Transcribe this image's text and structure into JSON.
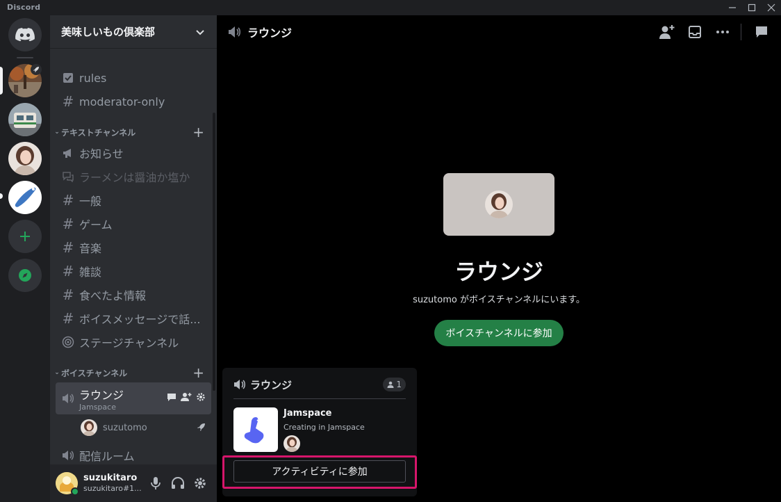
{
  "window": {
    "brand": "Discord"
  },
  "guild": {
    "name": "美味しいもの倶楽部"
  },
  "channels": {
    "top": [
      {
        "label": "rules",
        "icon": "rules-checkbox-icon"
      },
      {
        "label": "moderator-only",
        "icon": "locked-hash-icon"
      }
    ],
    "text_category": "テキストチャンネル",
    "text": [
      {
        "label": "お知らせ",
        "icon": "megaphone-icon"
      },
      {
        "label": "ラーメンは醤油か塩か",
        "icon": "forum-icon"
      },
      {
        "label": "一般",
        "icon": "hash-icon"
      },
      {
        "label": "ゲーム",
        "icon": "hash-icon"
      },
      {
        "label": "音楽",
        "icon": "hash-icon"
      },
      {
        "label": "雑談",
        "icon": "hash-icon"
      },
      {
        "label": "食べたよ情報",
        "icon": "hash-icon"
      },
      {
        "label": "ボイスメッセージで話...",
        "icon": "hash-icon"
      },
      {
        "label": "ステージチャンネル",
        "icon": "stage-icon"
      }
    ],
    "voice_category": "ボイスチャンネル",
    "voice_active": {
      "label": "ラウンジ",
      "sub": "Jamspace",
      "user": "suzutomo"
    },
    "voice_other": "配信ルーム"
  },
  "user": {
    "name": "suzukitaro",
    "tag": "suzukitaro#1..."
  },
  "main": {
    "header_title": "ラウンジ",
    "center_title": "ラウンジ",
    "center_sub": "suzutomo がボイスチャンネルにいます。",
    "join_label": "ボイスチャンネルに参加"
  },
  "popup": {
    "title": "ラウンジ",
    "count": "1",
    "app_name": "Jamspace",
    "app_sub": "Creating in Jamspace",
    "activity_button": "アクティビティに参加"
  },
  "colors": {
    "accent_green": "#248046",
    "highlight": "#d6166b",
    "online": "#23a55a"
  }
}
